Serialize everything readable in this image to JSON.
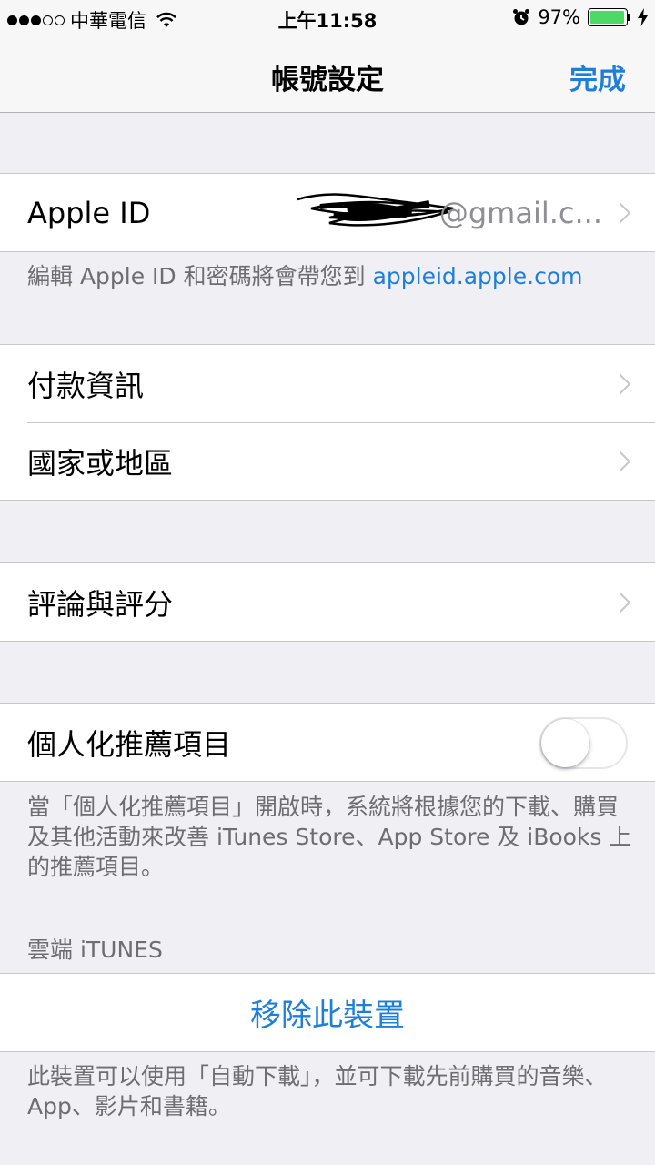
{
  "status_bar": {
    "carrier": "中華電信",
    "time": "上午11:58",
    "battery": "97%",
    "battery_level": 0.97,
    "signal_bars": 3
  },
  "nav": {
    "title": "帳號設定",
    "done_label": "完成"
  },
  "apple_id": {
    "label": "Apple ID",
    "value": "@gmail.c..."
  },
  "apple_id_note": {
    "text": "編輯 Apple ID 和密碼將會帶您到 ",
    "link": "appleid.apple.com"
  },
  "payment_group": [
    {
      "label": "付款資訊"
    },
    {
      "label": "國家或地區"
    }
  ],
  "ratings": {
    "label": "評論與評分"
  },
  "personalized": {
    "label": "個人化推薦項目",
    "enabled": false,
    "note": "當「個人化推薦項目」開啟時，系統將根據您的下載、購買及其他活動來改善 iTunes Store、App Store 及 iBooks 上的推薦項目。"
  },
  "itunes_cloud": {
    "header": "雲端 iTUNES",
    "remove_label": "移除此裝置",
    "note": "此裝置可以使用「自動下載」，並可下載先前購買的音樂、App、影片和書籍。"
  },
  "colors": {
    "accent": "#1f7fd8",
    "battery_green": "#4cd964",
    "background": "#efeff4"
  }
}
